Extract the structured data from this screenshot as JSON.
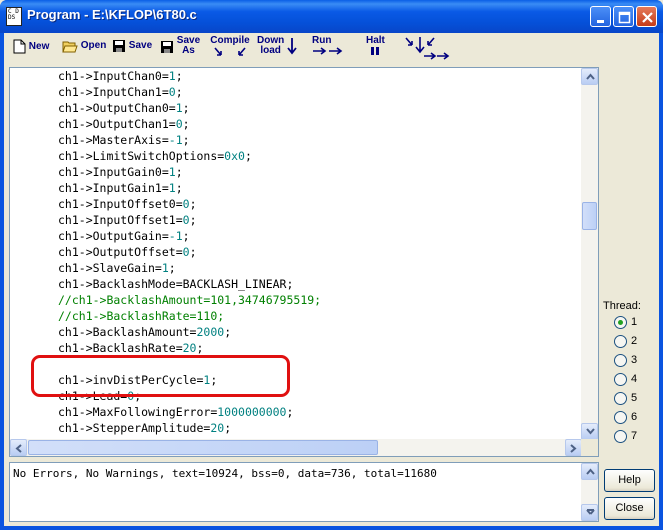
{
  "window": {
    "title": "Program - E:\\KFLOP\\6T80.c",
    "icon_text": "C  D\nDS"
  },
  "toolbar": {
    "new": "New",
    "open": "Open",
    "save": "Save",
    "save_as_1": "Save",
    "save_as_2": "As",
    "compile": "Compile",
    "download_1": "Down",
    "download_2": "load",
    "run": "Run",
    "halt": "Halt"
  },
  "code_lines": [
    [
      {
        "t": "ch1->InputChan0="
      },
      {
        "t": "1",
        "c": "num"
      },
      {
        "t": ";"
      }
    ],
    [
      {
        "t": "ch1->InputChan1="
      },
      {
        "t": "0",
        "c": "num"
      },
      {
        "t": ";"
      }
    ],
    [
      {
        "t": "ch1->OutputChan0="
      },
      {
        "t": "1",
        "c": "num"
      },
      {
        "t": ";"
      }
    ],
    [
      {
        "t": "ch1->OutputChan1="
      },
      {
        "t": "0",
        "c": "num"
      },
      {
        "t": ";"
      }
    ],
    [
      {
        "t": "ch1->MasterAxis="
      },
      {
        "t": "-1",
        "c": "num"
      },
      {
        "t": ";"
      }
    ],
    [
      {
        "t": "ch1->LimitSwitchOptions="
      },
      {
        "t": "0x0",
        "c": "num"
      },
      {
        "t": ";"
      }
    ],
    [
      {
        "t": "ch1->InputGain0="
      },
      {
        "t": "1",
        "c": "num"
      },
      {
        "t": ";"
      }
    ],
    [
      {
        "t": "ch1->InputGain1="
      },
      {
        "t": "1",
        "c": "num"
      },
      {
        "t": ";"
      }
    ],
    [
      {
        "t": "ch1->InputOffset0="
      },
      {
        "t": "0",
        "c": "num"
      },
      {
        "t": ";"
      }
    ],
    [
      {
        "t": "ch1->InputOffset1="
      },
      {
        "t": "0",
        "c": "num"
      },
      {
        "t": ";"
      }
    ],
    [
      {
        "t": "ch1->OutputGain="
      },
      {
        "t": "-1",
        "c": "num"
      },
      {
        "t": ";"
      }
    ],
    [
      {
        "t": "ch1->OutputOffset="
      },
      {
        "t": "0",
        "c": "num"
      },
      {
        "t": ";"
      }
    ],
    [
      {
        "t": "ch1->SlaveGain="
      },
      {
        "t": "1",
        "c": "num"
      },
      {
        "t": ";"
      }
    ],
    [
      {
        "t": "ch1->BacklashMode=BACKLASH_LINEAR;"
      }
    ],
    [
      {
        "t": "//ch1->BacklashAmount=101,34746795519;",
        "c": "cmt"
      }
    ],
    [
      {
        "t": "//ch1->BacklashRate=110;",
        "c": "cmt"
      }
    ],
    [
      {
        "t": "ch1->BacklashAmount="
      },
      {
        "t": "2000",
        "c": "num"
      },
      {
        "t": ";"
      }
    ],
    [
      {
        "t": "ch1->BacklashRate="
      },
      {
        "t": "20",
        "c": "num"
      },
      {
        "t": ";"
      }
    ],
    [],
    [
      {
        "t": "ch1->invDistPerCycle="
      },
      {
        "t": "1",
        "c": "num"
      },
      {
        "t": ";"
      }
    ],
    [
      {
        "t": "ch1->Lead="
      },
      {
        "t": "0",
        "c": "num"
      },
      {
        "t": ";"
      }
    ],
    [
      {
        "t": "ch1->MaxFollowingError="
      },
      {
        "t": "1000000000",
        "c": "num"
      },
      {
        "t": ";"
      }
    ],
    [
      {
        "t": "ch1->StepperAmplitude="
      },
      {
        "t": "20",
        "c": "num"
      },
      {
        "t": ";"
      }
    ]
  ],
  "threads": {
    "label": "Thread:",
    "options": [
      "1",
      "2",
      "3",
      "4",
      "5",
      "6",
      "7"
    ],
    "selected": "1"
  },
  "output": {
    "message": "No Errors, No Warnings, text=10924, bss=0, data=736, total=11680"
  },
  "buttons": {
    "help": "Help",
    "close": "Close"
  },
  "colors": {
    "number": "#008080",
    "comment": "#008000",
    "highlight": "#e01010",
    "toolbar_text": "#000080"
  }
}
